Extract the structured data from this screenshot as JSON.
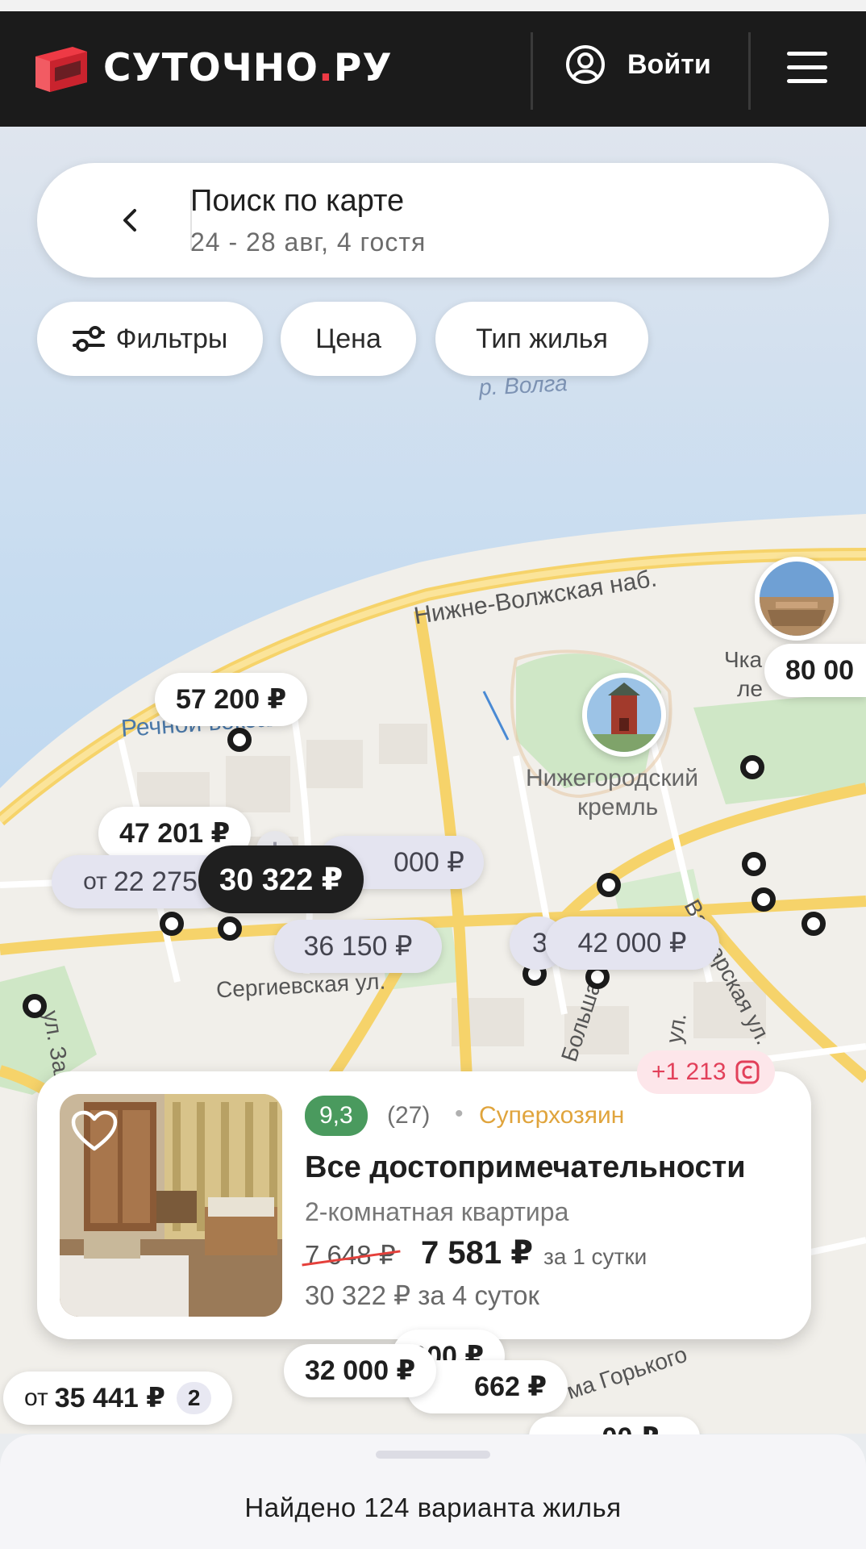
{
  "header": {
    "brand_name": "СУТОЧНО",
    "brand_dot": ".",
    "brand_suffix": "РУ",
    "login_label": "Войти",
    "icons": [
      "logo-icon",
      "user-circle-icon",
      "hamburger-menu-icon"
    ]
  },
  "search": {
    "title": "Поиск по карте",
    "subtitle": "24 - 28 авг, 4 гостя"
  },
  "chips": {
    "filters": "Фильтры",
    "price": "Цена",
    "type": "Тип жилья"
  },
  "map_labels": {
    "volga": "р. Волга",
    "embankment": "Нижне-Волжская наб.",
    "station": "Речной вокзал",
    "kremlin_1": "Нижегородский",
    "kremlin_2": "кремль",
    "sergievskaya": "Сергиевская ул.",
    "chkalov": "Чка",
    "chkalov_2": "ле",
    "varvarskaya": "Варварская ул.",
    "zalom": "ул. Заломо",
    "bolshaya": "Большая",
    "ul": "ул.",
    "gorkogo": "ма Горького"
  },
  "pins": {
    "p1": "57 200 ₽",
    "p2": "47 201 ₽",
    "p3_pre": "от",
    "p3": "22 275",
    "p4": "30 322 ₽",
    "p5": "000 ₽",
    "p6": "36 150 ₽",
    "p7": "3",
    "p8": "42 000 ₽",
    "p9": "80 00",
    "p10_pre": "от",
    "p10": "35 441 ₽",
    "p10_badge": "2",
    "p11": "32 000 ₽",
    "p12": "662 ₽",
    "p13": "000 ₽",
    "p14": "00 ₽"
  },
  "listing": {
    "rating": "9,3",
    "reviews": "(27)",
    "bullet": "•",
    "superhost": "Суперхозяин",
    "title": "Все достопримечательности",
    "type": "2-комнатная квартира",
    "old_price": "7 648 ₽",
    "new_price": "7 581 ₽",
    "per_night": "за 1 сутки",
    "total": "30 322 ₽ за 4 суток",
    "bonus": "+1 213"
  },
  "bottom": {
    "found": "Найдено 124 варианта жилья"
  },
  "colors": {
    "brand_red": "#ee3a45",
    "header_bg": "#1b1b1b",
    "water": "#b4d3ee",
    "rating_green": "#4a9a5e",
    "superhost_gold": "#e0a43c"
  }
}
